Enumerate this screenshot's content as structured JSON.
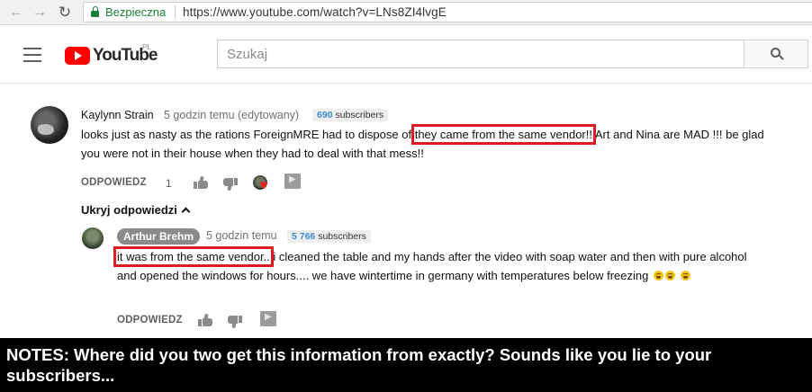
{
  "browser": {
    "secure_label": "Bezpieczna",
    "url": "https://www.youtube.com/watch?v=LNs8ZI4lvgE",
    "back_icon": "arrow-left-icon",
    "forward_icon": "arrow-right-icon",
    "reload_icon": "reload-icon"
  },
  "header": {
    "logo_text": "YouTube",
    "country": "PL",
    "search_placeholder": "Szukaj"
  },
  "comments": [
    {
      "author": "Kaylynn Strain",
      "timestamp": "5 godzin temu (edytowany)",
      "subscribers_num": "690",
      "subscribers_label": "subscribers",
      "text_before": "looks just as nasty as the rations ForeignMRE had to dispose of",
      "text_highlight": "they came from the same vendor!!",
      "text_after": " Art and Nina are MAD !!!  be glad you were not in their house when they had to deal with that mess!!",
      "reply_label": "ODPOWIEDZ",
      "likes": "1"
    },
    {
      "author": "Arthur Brehm",
      "timestamp": "5 godzin temu",
      "subscribers_num": "5 766",
      "subscribers_label": "subscribers",
      "text_highlight": "it was from the same vendor..",
      "text_after": " i cleaned the table and my hands after the video with soap water and then with pure alcohol and opened the windows for hours.... we have wintertime in germany with temperatures below freezing",
      "reply_label": "ODPOWIEDZ"
    }
  ],
  "hide_replies_label": "Ukryj odpowiedzi",
  "notes": "NOTES: Where did you two get this information from exactly? Sounds like you lie to your subscribers..."
}
